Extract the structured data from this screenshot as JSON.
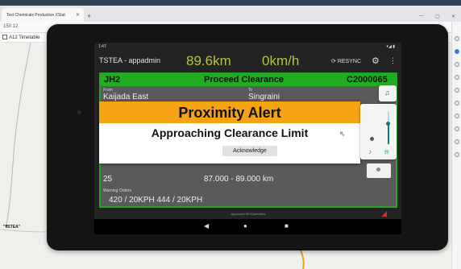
{
  "browser": {
    "tab_title": "Test Chemicals Production XStat",
    "address": "150.12",
    "bookmark": "A12 Timetable"
  },
  "map": {
    "label": "TSTEA"
  },
  "tablet": {
    "status_time": "1:47",
    "status_right": "▾◢ ▮",
    "app_title": "TSTEA - appadmin",
    "speed_distance": "89.6km",
    "speed_current": "0km/h",
    "resync_label": "RESYNC",
    "header": {
      "left": "JH2",
      "center": "Proceed Clearance",
      "right": "C2000065"
    },
    "from_label": "From",
    "to_label": "To",
    "from_value": "Kaijada East",
    "to_value": "Singraini",
    "row1_left": "25",
    "row1_right": "87.000 - 89.000 km",
    "warning_label": "Warning Orders",
    "warning_values": "420 / 20KPH    444 / 20KPH",
    "dialog": {
      "title": "Proximity Alert",
      "subtitle": "Approaching Clearance Limit",
      "button": "Acknowledge"
    },
    "bottom_hint": "Approach 89 Kilometres"
  },
  "colors": {
    "header_green": "#21ad21",
    "alert_orange": "#f5a213",
    "speed_yellow": "#b9c445",
    "volume_teal": "#0f7c70"
  },
  "volume": {
    "level_fraction": 0.65
  }
}
